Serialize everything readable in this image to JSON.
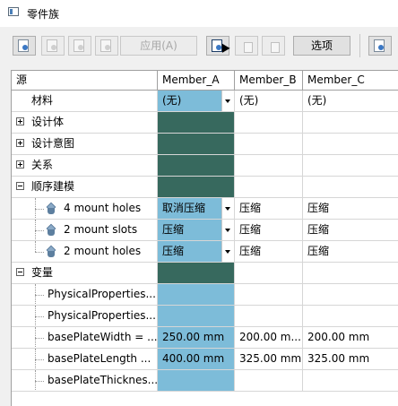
{
  "window": {
    "title": "零件族"
  },
  "toolbar": {
    "apply_label": "应用(A)",
    "options_label": "选项"
  },
  "grid": {
    "headers": {
      "source": "源",
      "member_a": "Member_A",
      "member_b": "Member_B",
      "member_c": "Member_C"
    },
    "rows": [
      {
        "label": "材料",
        "a": "(无)",
        "b": "(无)",
        "c": "(无)"
      },
      {
        "label": "设计体"
      },
      {
        "label": "设计意图"
      },
      {
        "label": "关系"
      },
      {
        "label": "顺序建模"
      },
      {
        "label": "4 mount holes",
        "a": "取消压缩",
        "b": "压缩",
        "c": "压缩"
      },
      {
        "label": "2 mount slots",
        "a": "压缩",
        "b": "压缩",
        "c": "压缩"
      },
      {
        "label": "2 mount holes",
        "a": "压缩",
        "b": "压缩",
        "c": "压缩"
      },
      {
        "label": "变量"
      },
      {
        "label": "PhysicalProperties..."
      },
      {
        "label": "PhysicalProperties..."
      },
      {
        "label": "basePlateWidth = ...",
        "a": "250.00 mm",
        "b": "200.00 m...",
        "c": "200.00 mm"
      },
      {
        "label": "basePlateLength ...",
        "a": "400.00 mm",
        "b": "325.00 mm",
        "c": "325.00 mm"
      },
      {
        "label": "basePlateThicknes..."
      }
    ]
  },
  "colors": {
    "member_a_highlight": "#7dbcd9",
    "member_a_group": "#37695e"
  }
}
